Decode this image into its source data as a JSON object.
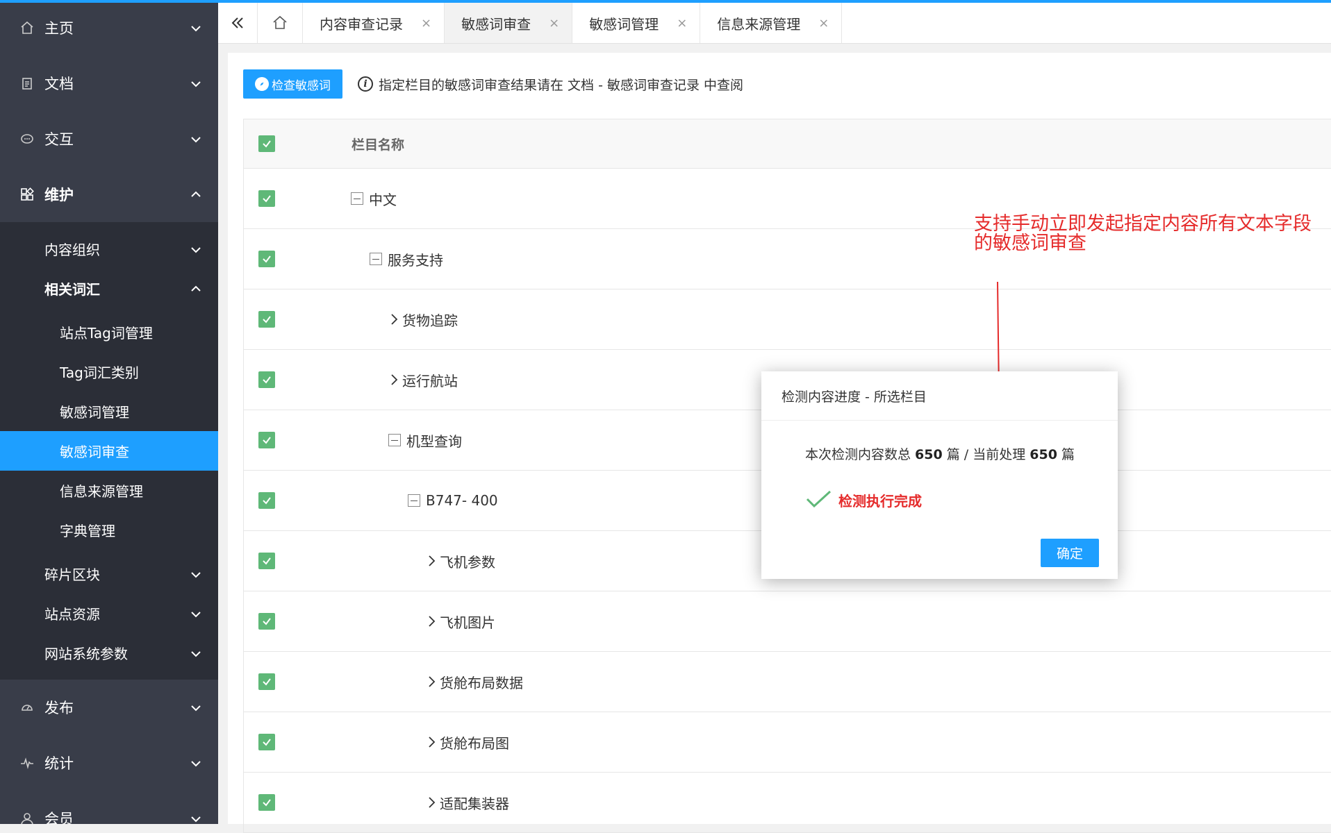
{
  "sidebar": {
    "top": [
      {
        "label": "主页",
        "icon": "home-icon"
      },
      {
        "label": "文档",
        "icon": "document-icon"
      },
      {
        "label": "交互",
        "icon": "chat-icon"
      },
      {
        "label": "维护",
        "icon": "apps-icon"
      }
    ],
    "sub": {
      "content_org": "内容组织",
      "related_terms": "相关词汇",
      "leaves": [
        "站点Tag词管理",
        "Tag词汇类别",
        "敏感词管理",
        "敏感词审查",
        "信息来源管理",
        "字典管理"
      ],
      "fragments": "碎片区块",
      "site_resources": "站点资源",
      "site_params": "网站系统参数"
    },
    "bottom": [
      {
        "label": "发布",
        "icon": "gauge-icon"
      },
      {
        "label": "统计",
        "icon": "pulse-icon"
      },
      {
        "label": "会员",
        "icon": "user-icon"
      }
    ]
  },
  "tabs": [
    "内容审查记录",
    "敏感词审查",
    "敏感词管理",
    "信息来源管理"
  ],
  "toolbar": {
    "check_button": "检查敏感词",
    "notice": "指定栏目的敏感词审查结果请在 文档 - 敏感词审查记录 中查阅"
  },
  "table": {
    "header": "栏目名称",
    "rows": [
      {
        "label": "中文",
        "marker": "minus"
      },
      {
        "label": "服务支持",
        "marker": "minus"
      },
      {
        "label": "货物追踪",
        "marker": "chevron"
      },
      {
        "label": "运行航站",
        "marker": "chevron"
      },
      {
        "label": "机型查询",
        "marker": "minus"
      },
      {
        "label": "B747- 400",
        "marker": "minus"
      },
      {
        "label": "飞机参数",
        "marker": "chevron"
      },
      {
        "label": "飞机图片",
        "marker": "chevron"
      },
      {
        "label": "货舱布局数据",
        "marker": "chevron"
      },
      {
        "label": "货舱布局图",
        "marker": "chevron"
      },
      {
        "label": "适配集装器",
        "marker": "chevron"
      }
    ]
  },
  "annotation": {
    "line1": "支持手动立即发起指定内容所有文本字段",
    "line2": "的敏感词审查"
  },
  "dialog": {
    "title": "检测内容进度 - 所选栏目",
    "msg_pre": "本次检测内容数总 ",
    "total": "650",
    "msg_mid": " 篇 / 当前处理 ",
    "processed": "650",
    "msg_post": " 篇",
    "status": "检测执行完成",
    "confirm": "确定"
  },
  "colors": {
    "accent": "#1e9fff",
    "sidebar": "#393d49",
    "checkbox": "#5fb878",
    "annotation": "#e52b2b"
  }
}
